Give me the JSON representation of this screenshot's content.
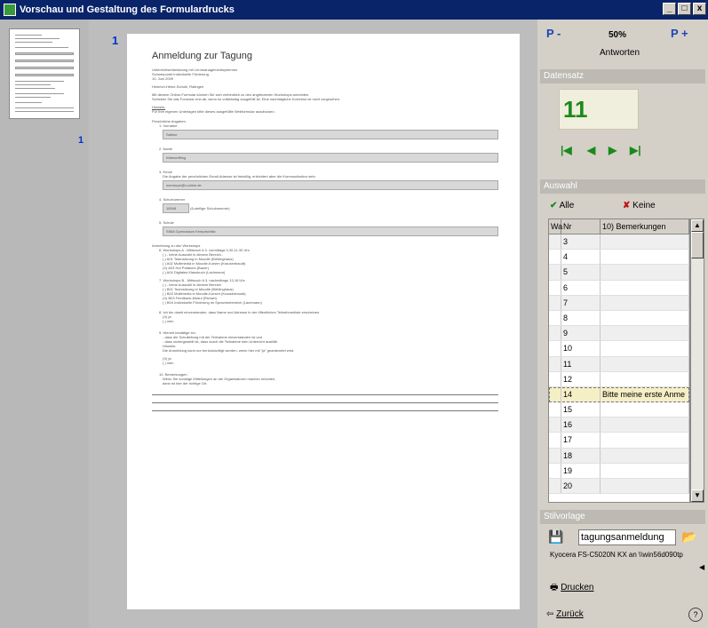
{
  "window": {
    "title": "Vorschau und Gestaltung des Formulardrucks",
    "min": "_",
    "max": "□",
    "close": "x"
  },
  "thumbnail": {
    "page_number": "1"
  },
  "document": {
    "page_number": "1",
    "title": "Anmeldung zur Tagung",
    "subtitle_lines": [
      "Unterrichtsentwicklung mit Lernmanagementsystemen",
      "Schwerpunkt Individuelle Förderung",
      "10. Juni 2009"
    ],
    "author": "Heinrich-Heine-Schule, Ratingen",
    "intro_lines": [
      "Mit diesem Online-Formular können Sie sich verbindlich zu den angebotenen Workshops anmelden.",
      "Schicken Sie das Formular erst ab, wenn es vollständig ausgefüllt ist. Eine nachträgliche Korrektur ist nicht vorgesehen."
    ],
    "hint_label": "Hinweis:",
    "hint_text": "Für Ihre eigenen Unterlagen bitte dieses ausgefüllte Webformular ausdrucken.",
    "personal_heading": "Persönliche Angaben",
    "fields": [
      {
        "num": "1.",
        "label": "Vorname",
        "value": "Sabine"
      },
      {
        "num": "2.",
        "label": "Name",
        "value": "Kittenerffling"
      },
      {
        "num": "3.",
        "label": "Email",
        "note": "Die Angabe der persönlichen Email-Adresse ist freiwillig, erleichtert aber die Kommunikation sehr.",
        "value": "mentorpe@t-online.de"
      },
      {
        "num": "4.",
        "label": "Schulnummer",
        "value": "16548",
        "suffix": "(6-stellige Schulnummer)"
      },
      {
        "num": "5.",
        "label": "Schule",
        "value": "SIMA Gymnasium Kempischlitz"
      }
    ],
    "workshop_heading": "Anmeldung zu den Workshops",
    "workshop_a": {
      "num": "6.",
      "title": "Workshops A - Mittwoch 6.3. vormittags 9.30-11.30 Uhr",
      "options": [
        "( ) - keine Auswahl in diesem Bereich -",
        "( ) A01 Teamsitzung in Moodle (Böhlinghaus)",
        "( ) A02 Multimedia in Moodle-Kursen (Krausenbaudt)",
        "(X) A03 Hot Potatoes (Bauer)",
        "( ) A04 Digitales Klassbuch (Lachmann)"
      ]
    },
    "workshop_b": {
      "num": "7.",
      "title": "Workshops B - Mittwoch 6.3. nachmittags 13-16 Uhr",
      "options": [
        "( ) - keine Auswahl in diesem Bereich",
        "( ) B01 Teamsitzung in Moodle (Böhlinghaus)",
        "( ) B02 Multimedia in Moodle-Kursen (Krausenbaudt)",
        "(X) B03 Feedback-Modul (Richart)",
        "( ) B04 Individuelle Förderung im Sprachenbereich (Lachmann)"
      ]
    },
    "consent": {
      "num": "8.",
      "text": "Ich bin damit einverstanden, dass Name und Adresse in der öffentlichen Teilnehmerliste erscheinen.",
      "options": [
        "(X) ja",
        "( ) nein"
      ]
    },
    "confirm": {
      "num": "9.",
      "title": "Hiermit bestätige ich,",
      "lines": [
        "- dass die Schulleitung mit der Teilnahme einverstanden ist und",
        "- dass sichergestellt ist, dass durch die Teilnahme kein Unterricht ausfällt.",
        "Hinweis:",
        "Die Anmeldung kann nur berücksichtigt werden, wenn hier mit \"ja\" geantwortet wird."
      ],
      "options": [
        "(X) ja",
        "( ) nein"
      ]
    },
    "remarks": {
      "num": "10.",
      "title": "Bemerkungen",
      "lines": [
        "Wenn Sie sonstige Mitteilungen an die Organisatoren machen möchten,",
        "dann ist hier der richtige Ort."
      ]
    }
  },
  "sidebar": {
    "zoom_out": "P -",
    "zoom_level": "50%",
    "zoom_in": "P +",
    "answers_label": "Antworten",
    "dataset_header": "Datensatz",
    "record_number": "11",
    "nav": {
      "first": "|◀",
      "prev": "◀",
      "next": "▶",
      "last": "▶|"
    },
    "selection_header": "Auswahl",
    "all_label": "Alle",
    "none_label": "Keine",
    "grid": {
      "headers": [
        "Wa",
        "Nr",
        "10) Bemerkungen"
      ],
      "rows": [
        {
          "nr": "3",
          "rem": ""
        },
        {
          "nr": "4",
          "rem": ""
        },
        {
          "nr": "5",
          "rem": ""
        },
        {
          "nr": "6",
          "rem": ""
        },
        {
          "nr": "7",
          "rem": ""
        },
        {
          "nr": "8",
          "rem": ""
        },
        {
          "nr": "9",
          "rem": ""
        },
        {
          "nr": "10",
          "rem": ""
        },
        {
          "nr": "11",
          "rem": ""
        },
        {
          "nr": "12",
          "rem": ""
        },
        {
          "nr": "14",
          "rem": "Bitte meine erste Anme"
        },
        {
          "nr": "15",
          "rem": ""
        },
        {
          "nr": "16",
          "rem": ""
        },
        {
          "nr": "17",
          "rem": ""
        },
        {
          "nr": "18",
          "rem": ""
        },
        {
          "nr": "19",
          "rem": ""
        },
        {
          "nr": "20",
          "rem": ""
        }
      ]
    },
    "template_header": "Stilvorlage",
    "template_value": "tagungsanmeldung",
    "printer": "Kyocera FS-C5020N KX an \\\\win56d090tp",
    "print_label": "Drucken",
    "back_label": "Zurück",
    "help_label": "?"
  }
}
